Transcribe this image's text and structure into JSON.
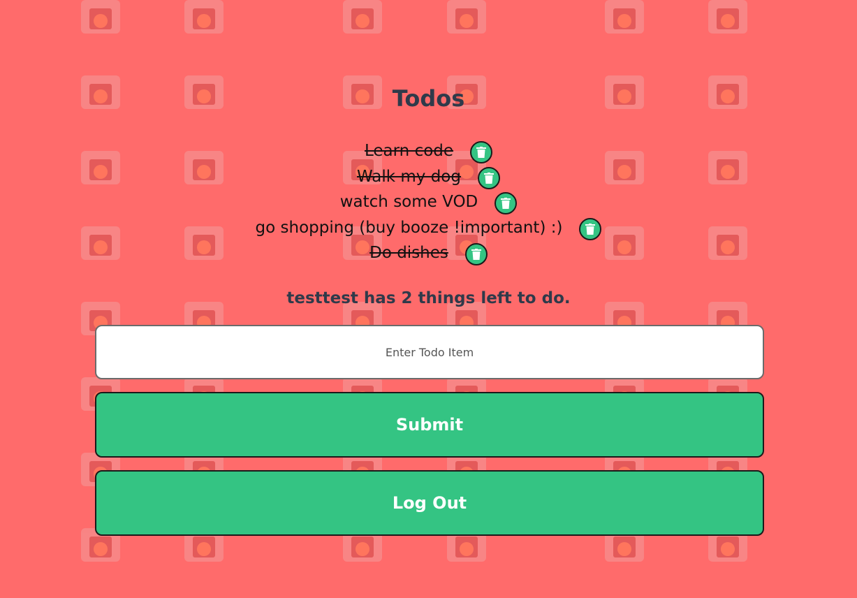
{
  "page": {
    "title": "Todos",
    "background_color": "#ff6b6b",
    "accent_color": "#34c483"
  },
  "todos": [
    {
      "text": "Learn code",
      "completed": true,
      "delete_icon": "trash-icon"
    },
    {
      "text": "Walk my dog",
      "completed": true,
      "delete_icon": "trash-icon"
    },
    {
      "text": "watch some VOD",
      "completed": false,
      "delete_icon": "trash-icon"
    },
    {
      "text": "go shopping (buy booze !important) :)",
      "completed": false,
      "delete_icon": "trash-icon"
    },
    {
      "text": "Do dishes",
      "completed": true,
      "delete_icon": "trash-icon"
    }
  ],
  "summary": "testtest has 2 things left to do.",
  "form": {
    "input_value": "",
    "input_placeholder": "Enter Todo Item",
    "submit_label": "Submit",
    "logout_label": "Log Out"
  }
}
